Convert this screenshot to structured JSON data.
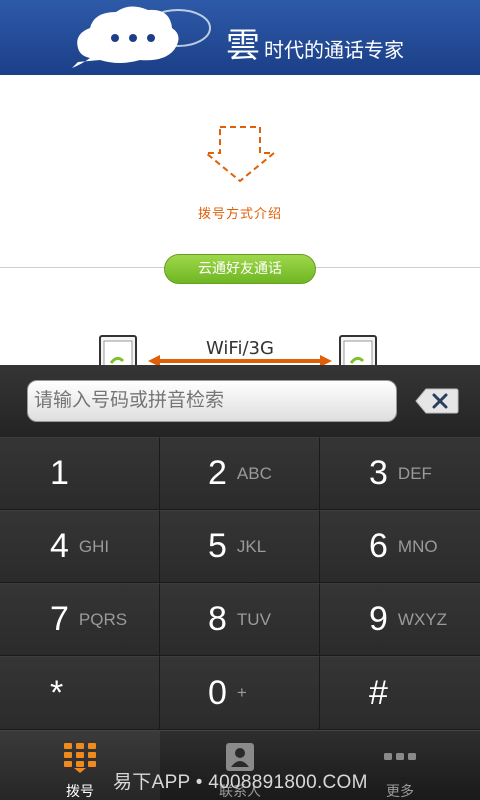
{
  "banner": {
    "logo_char": "雲",
    "tagline": "时代的通话专家"
  },
  "intro": {
    "dial_intro_label": "拨号方式介绍",
    "friend_call_label": "云通好友通话",
    "network_label": "WiFi/3G"
  },
  "dialer": {
    "search_placeholder": "请输入号码或拼音检索",
    "keys": [
      {
        "digit": "1",
        "letters": ""
      },
      {
        "digit": "2",
        "letters": "ABC"
      },
      {
        "digit": "3",
        "letters": "DEF"
      },
      {
        "digit": "4",
        "letters": "GHI"
      },
      {
        "digit": "5",
        "letters": "JKL"
      },
      {
        "digit": "6",
        "letters": "MNO"
      },
      {
        "digit": "7",
        "letters": "PQRS"
      },
      {
        "digit": "8",
        "letters": "TUV"
      },
      {
        "digit": "9",
        "letters": "WXYZ"
      },
      {
        "digit": "*",
        "letters": ""
      },
      {
        "digit": "0",
        "letters": "+"
      },
      {
        "digit": "#",
        "letters": ""
      }
    ]
  },
  "tabs": [
    {
      "label": "拨号",
      "icon": "dialpad-icon",
      "active": true
    },
    {
      "label": "联系人",
      "icon": "contacts-icon",
      "active": false
    },
    {
      "label": "更多",
      "icon": "more-icon",
      "active": false
    }
  ],
  "watermark": "易下APP • 4008891800.COM",
  "colors": {
    "banner": "#1c3f88",
    "accent_orange": "#e0600a",
    "pill_green": "#7cc22e",
    "dialer_bg": "#2a2a2a"
  }
}
